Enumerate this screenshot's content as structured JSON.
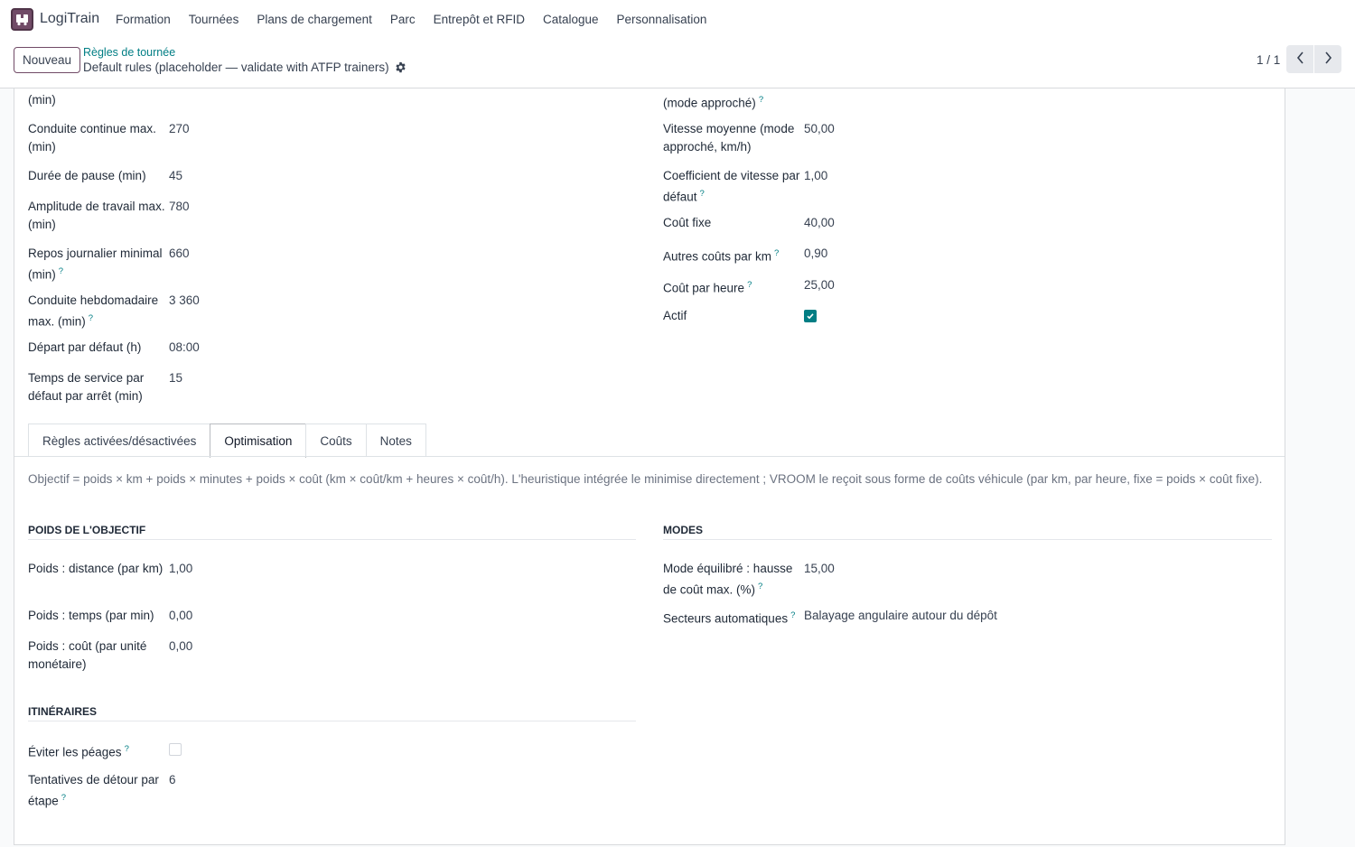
{
  "navbar": {
    "app_name": "LogiTrain",
    "menu": [
      "Formation",
      "Tournées",
      "Plans de chargement",
      "Parc",
      "Entrepôt et RFID",
      "Catalogue",
      "Personnalisation"
    ]
  },
  "control": {
    "new_label": "Nouveau",
    "breadcrumb": "Règles de tournée",
    "record_title": "Default rules (placeholder — validate with ATFP trainers)",
    "pager": "1 / 1"
  },
  "left_fields": [
    {
      "label": "(min)",
      "value": "",
      "tip": false
    },
    {
      "label": "Conduite continue max. (min)",
      "value": "270",
      "tip": false
    },
    {
      "label": "Durée de pause (min)",
      "value": "45",
      "tip": false
    },
    {
      "label": "Amplitude de travail max. (min)",
      "value": "780",
      "tip": false
    },
    {
      "label": "Repos journalier minimal (min)",
      "value": "660",
      "tip": true
    },
    {
      "label": "Conduite hebdomadaire max. (min)",
      "value": "3 360",
      "tip": true
    },
    {
      "label": "Départ par défaut (h)",
      "value": "08:00",
      "tip": false
    },
    {
      "label": "Temps de service par défaut par arrêt (min)",
      "value": "15",
      "tip": false
    }
  ],
  "right_fields": [
    {
      "label": "(mode approché)",
      "value": "",
      "tip": true
    },
    {
      "label": "Vitesse moyenne (mode approché, km/h)",
      "value": "50,00",
      "tip": false
    },
    {
      "label": "Coefficient de vitesse par défaut",
      "value": "1,00",
      "tip": true
    },
    {
      "label": "Coût fixe",
      "value": "40,00",
      "tip": false
    },
    {
      "label": "Autres coûts par km",
      "value": "0,90",
      "tip": true
    },
    {
      "label": "Coût par heure",
      "value": "25,00",
      "tip": true
    },
    {
      "label": "Actif",
      "checked": true,
      "tip": false
    }
  ],
  "tabs": [
    "Règles activées/désactivées",
    "Optimisation",
    "Coûts",
    "Notes"
  ],
  "active_tab": "Optimisation",
  "optimisation": {
    "help": "Objectif = poids × km + poids × minutes + poids × coût (km × coût/km + heures × coût/h). L'heuristique intégrée le minimise directement ; VROOM le reçoit sous forme de coûts véhicule (par km, par heure, fixe = poids × coût fixe).",
    "objective_title": "POIDS DE L'OBJECTIF",
    "objective_fields": [
      {
        "label": "Poids : distance (par km)",
        "value": "1,00",
        "tip": false
      },
      {
        "label": "Poids : temps (par min)",
        "value": "0,00",
        "tip": false
      },
      {
        "label": "Poids : coût (par unité monétaire)",
        "value": "0,00",
        "tip": false
      }
    ],
    "modes_title": "MODES",
    "modes_fields": [
      {
        "label": "Mode équilibré : hausse de coût max. (%)",
        "value": "15,00",
        "tip": true
      },
      {
        "label": "Secteurs automatiques",
        "value": "Balayage angulaire autour du dépôt",
        "tip": true
      }
    ],
    "routes_title": "ITINÉRAIRES",
    "routes_fields": [
      {
        "label": "Éviter les péages",
        "checked": false,
        "tip": true
      },
      {
        "label": "Tentatives de détour par étape",
        "value": "6",
        "tip": true
      }
    ]
  },
  "colors": {
    "accent": "#017e84",
    "brand": "#714b67"
  }
}
